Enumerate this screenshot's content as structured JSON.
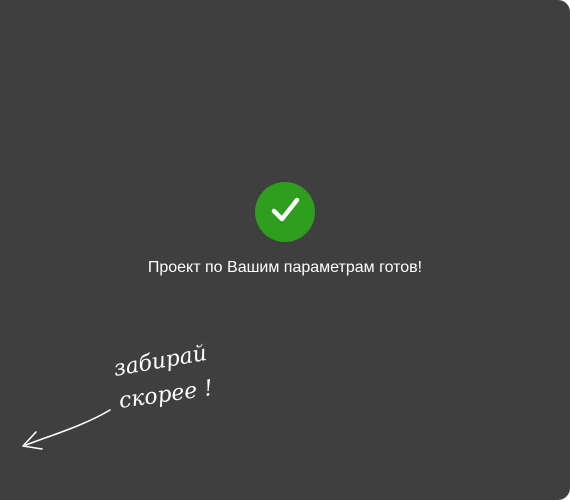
{
  "status": {
    "icon": "checkmark-icon",
    "accent_color": "#2f9e1f",
    "message": "Проект по Вашим параметрам готов!"
  },
  "handnote": {
    "line1": "забирай",
    "line2": "скорее !",
    "arrow_icon": "hand-drawn-arrow-left-icon"
  }
}
